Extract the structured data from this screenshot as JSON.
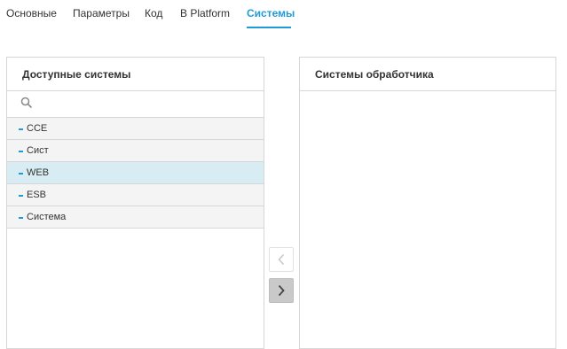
{
  "tabs": [
    {
      "label": "Основные",
      "active": false
    },
    {
      "label": "Параметры",
      "active": false
    },
    {
      "label": "Код",
      "active": false
    },
    {
      "label": "В Platform",
      "active": false
    },
    {
      "label": "Системы",
      "active": true
    }
  ],
  "available": {
    "title": "Доступные системы",
    "search": {
      "value": "",
      "placeholder": ""
    },
    "items": [
      {
        "label": "CCE",
        "selected": false
      },
      {
        "label": "Сист",
        "selected": false
      },
      {
        "label": "WEB",
        "selected": true
      },
      {
        "label": "ESB",
        "selected": false
      },
      {
        "label": "Система",
        "selected": false
      }
    ]
  },
  "handler": {
    "title": "Системы обработчика",
    "items": []
  },
  "buttons": {
    "move_left_icon": "chevron-left-icon",
    "move_right_icon": "chevron-right-icon"
  },
  "colors": {
    "accent": "#1e9bd7",
    "selected_row": "#d7edf3",
    "row": "#f4f4f4",
    "border": "#d6d6d6"
  }
}
